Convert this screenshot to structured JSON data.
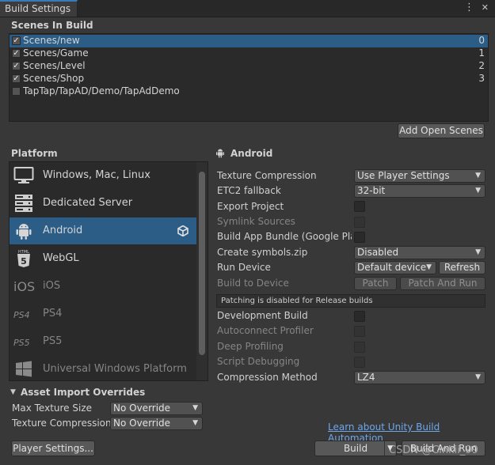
{
  "window": {
    "tab_title": "Build Settings",
    "menu_glyph": "⋮",
    "close_glyph": "✕"
  },
  "scenes": {
    "heading": "Scenes In Build",
    "items": [
      {
        "name": "Scenes/new",
        "index": "0",
        "checked": true,
        "selected": true
      },
      {
        "name": "Scenes/Game",
        "index": "1",
        "checked": true,
        "selected": false
      },
      {
        "name": "Scenes/Level",
        "index": "2",
        "checked": true,
        "selected": false
      },
      {
        "name": "Scenes/Shop",
        "index": "3",
        "checked": true,
        "selected": false
      },
      {
        "name": "TapTap/TapAD/Demo/TapAdDemo",
        "index": "",
        "checked": false,
        "selected": false
      }
    ],
    "add_open_scenes_label": "Add Open Scenes"
  },
  "platform": {
    "heading": "Platform",
    "items": [
      {
        "label": "Windows, Mac, Linux",
        "icon": "monitor-icon",
        "dim": false,
        "selected": false
      },
      {
        "label": "Dedicated Server",
        "icon": "server-icon",
        "dim": false,
        "selected": false
      },
      {
        "label": "Android",
        "icon": "android-icon",
        "dim": false,
        "selected": true
      },
      {
        "label": "WebGL",
        "icon": "html5-icon",
        "dim": false,
        "selected": false
      },
      {
        "label": "iOS",
        "icon": "ios-icon",
        "dim": true,
        "selected": false
      },
      {
        "label": "PS4",
        "icon": "ps4-icon",
        "dim": true,
        "selected": false
      },
      {
        "label": "PS5",
        "icon": "ps5-icon",
        "dim": true,
        "selected": false
      },
      {
        "label": "Universal Windows Platform",
        "icon": "windows-icon",
        "dim": true,
        "selected": false
      }
    ],
    "icon_text": {
      "html5_top": "HTML",
      "html5_num": "5",
      "ios": "iOS",
      "ps4": "PS4",
      "ps5": "PS5"
    }
  },
  "asset_import": {
    "heading": "Asset Import Overrides",
    "max_texture_size_label": "Max Texture Size",
    "max_texture_size_value": "No Override",
    "texture_compression_label": "Texture Compression",
    "texture_compression_value": "No Override"
  },
  "android": {
    "heading": "Android",
    "texture_compression_label": "Texture Compression",
    "texture_compression_value": "Use Player Settings",
    "etc2_fallback_label": "ETC2 fallback",
    "etc2_fallback_value": "32-bit",
    "export_project_label": "Export Project",
    "symlink_sources_label": "Symlink Sources",
    "build_app_bundle_label": "Build App Bundle (Google Play",
    "create_symbols_label": "Create symbols.zip",
    "create_symbols_value": "Disabled",
    "run_device_label": "Run Device",
    "run_device_value": "Default device",
    "refresh_label": "Refresh",
    "build_to_device_label": "Build to Device",
    "patch_label": "Patch",
    "patch_and_run_label": "Patch And Run",
    "patching_info": "Patching is disabled for Release builds",
    "development_build_label": "Development Build",
    "autoconnect_profiler_label": "Autoconnect Profiler",
    "deep_profiling_label": "Deep Profiling",
    "script_debugging_label": "Script Debugging",
    "compression_method_label": "Compression Method",
    "compression_method_value": "LZ4"
  },
  "footer": {
    "learn_link": "Learn about Unity Build Automation",
    "player_settings_label": "Player Settings...",
    "build_label": "Build",
    "build_and_run_label": "Build And Run"
  },
  "watermark": "CSDN @Cinkii_99",
  "colors": {
    "selection": "#2c5d87",
    "accent_tab": "#3a79bb",
    "link": "#6ea6e8"
  }
}
